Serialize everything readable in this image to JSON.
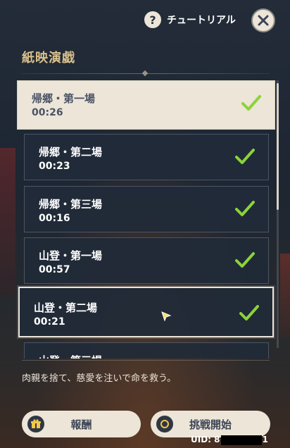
{
  "header": {
    "help_label": "チュートリアル",
    "help_icon": "question-icon",
    "close_icon": "close-icon"
  },
  "title": "紙映演戯",
  "items": [
    {
      "name": "帰郷・第一場",
      "time": "00:26",
      "completed": true
    },
    {
      "name": "帰郷・第二場",
      "time": "00:23",
      "completed": true
    },
    {
      "name": "帰郷・第三場",
      "time": "00:16",
      "completed": true
    },
    {
      "name": "山登・第一場",
      "time": "00:57",
      "completed": true
    },
    {
      "name": "山登・第二場",
      "time": "00:21",
      "completed": true
    },
    {
      "name": "山登・第三場",
      "time": "",
      "completed": false
    }
  ],
  "description": "肉親を捨て、慈愛を注いで命を救う。",
  "buttons": {
    "reward_label": "報酬",
    "reward_icon": "gift-icon",
    "start_label": "挑戦開始",
    "start_icon": "circle-icon"
  },
  "uid": {
    "prefix": "UID: 8",
    "suffix": "1"
  },
  "colors": {
    "accent_gold": "#d9c08d",
    "panel_light": "#ece5d8",
    "panel_dark": "#212a38",
    "check_green": "#8bd33a"
  }
}
